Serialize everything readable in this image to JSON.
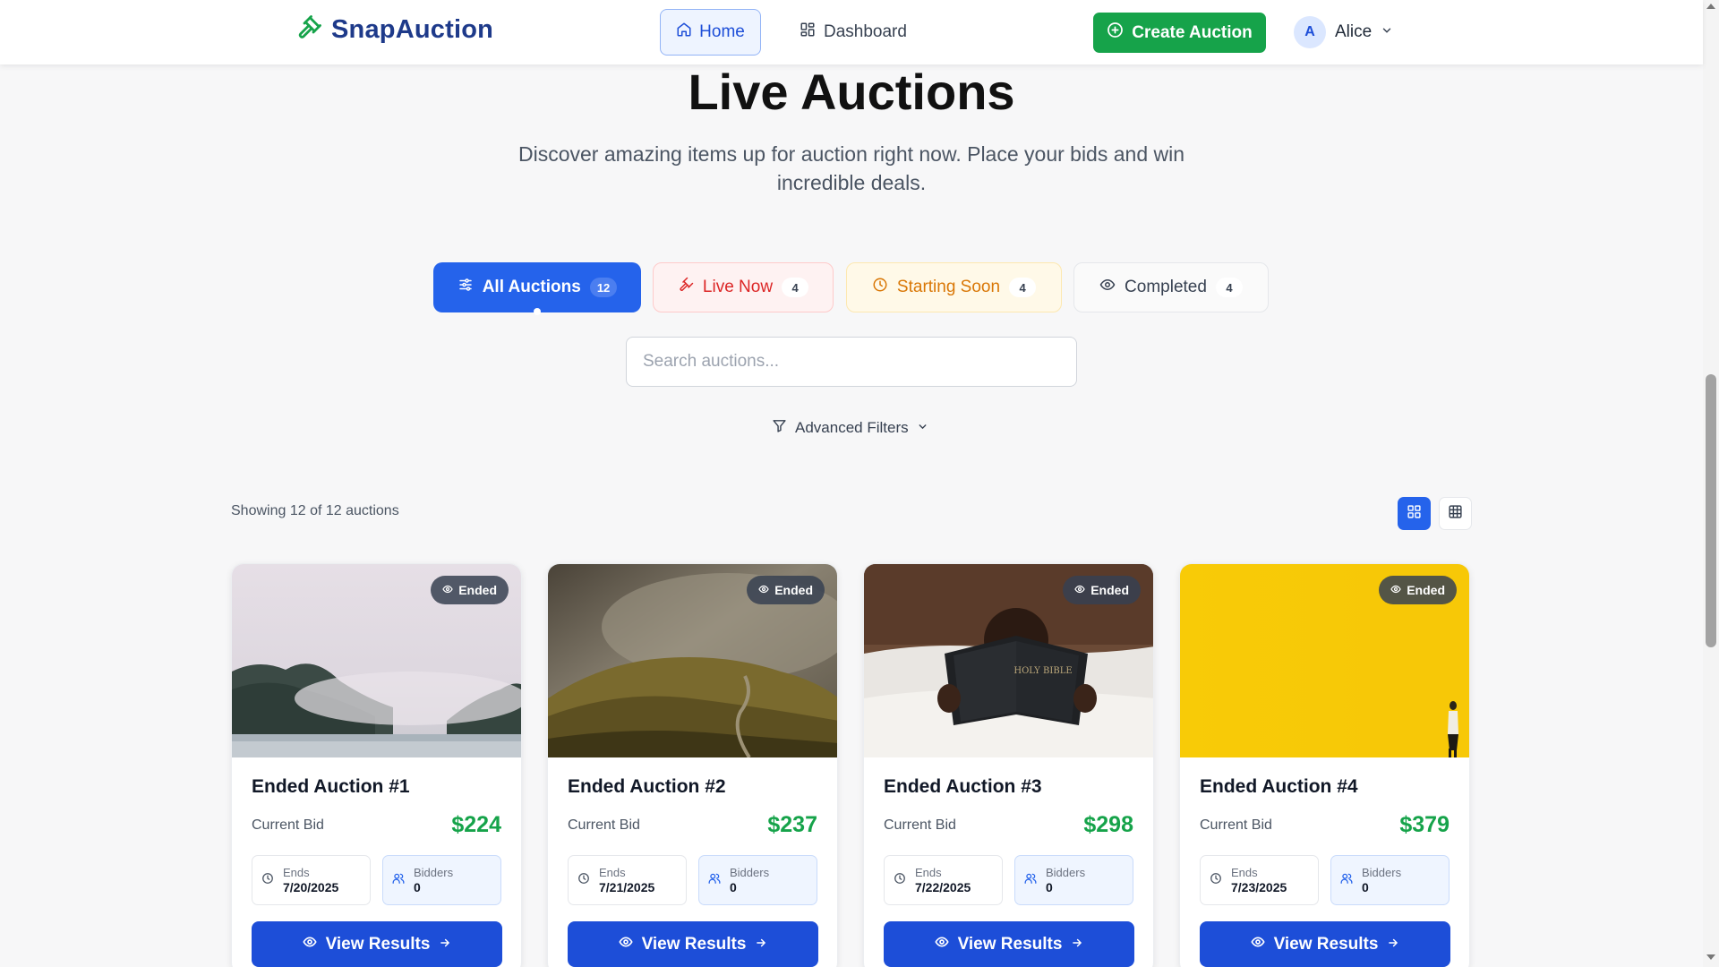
{
  "nav": {
    "brand": "SnapAuction",
    "home_label": "Home",
    "dashboard_label": "Dashboard",
    "create_label": "Create Auction",
    "user_initial": "A",
    "user_name": "Alice"
  },
  "hero": {
    "title": "Live Auctions",
    "subtitle": "Discover amazing items up for auction right now. Place your bids and win incredible deals."
  },
  "tabs": [
    {
      "label": "All Auctions",
      "count": "12"
    },
    {
      "label": "Live Now",
      "count": "4"
    },
    {
      "label": "Starting Soon",
      "count": "4"
    },
    {
      "label": "Completed",
      "count": "4"
    }
  ],
  "search": {
    "placeholder": "Search auctions...",
    "value": ""
  },
  "filters": {
    "advanced_label": "Advanced Filters"
  },
  "results": {
    "showing_text": "Showing 12 of 12 auctions",
    "active_view": "grid"
  },
  "colors": {
    "primary": "#2563eb",
    "success": "#16a34a",
    "brand": "#1e3a8a",
    "live": "#dc2626",
    "soon": "#d97706"
  },
  "cards": [
    {
      "title": "Ended Auction #1",
      "status": "Ended",
      "bid_label": "Current Bid",
      "bid": "$224",
      "ends_label": "Ends",
      "ends": "7/20/2025",
      "bidders_label": "Bidders",
      "bidders": "0",
      "action": "View Results",
      "image": "misty-forest-lake"
    },
    {
      "title": "Ended Auction #2",
      "status": "Ended",
      "bid_label": "Current Bid",
      "bid": "$237",
      "ends_label": "Ends",
      "ends": "7/21/2025",
      "bidders_label": "Bidders",
      "bidders": "0",
      "action": "View Results",
      "image": "foggy-hillside-path"
    },
    {
      "title": "Ended Auction #3",
      "status": "Ended",
      "bid_label": "Current Bid",
      "bid": "$298",
      "ends_label": "Ends",
      "ends": "7/22/2025",
      "bidders_label": "Bidders",
      "bidders": "0",
      "action": "View Results",
      "image": "child-reading-bible",
      "image_text": "HOLY BIBLE"
    },
    {
      "title": "Ended Auction #4",
      "status": "Ended",
      "bid_label": "Current Bid",
      "bid": "$379",
      "ends_label": "Ends",
      "ends": "7/23/2025",
      "bidders_label": "Bidders",
      "bidders": "0",
      "action": "View Results",
      "image": "yellow-wall-walker"
    }
  ]
}
